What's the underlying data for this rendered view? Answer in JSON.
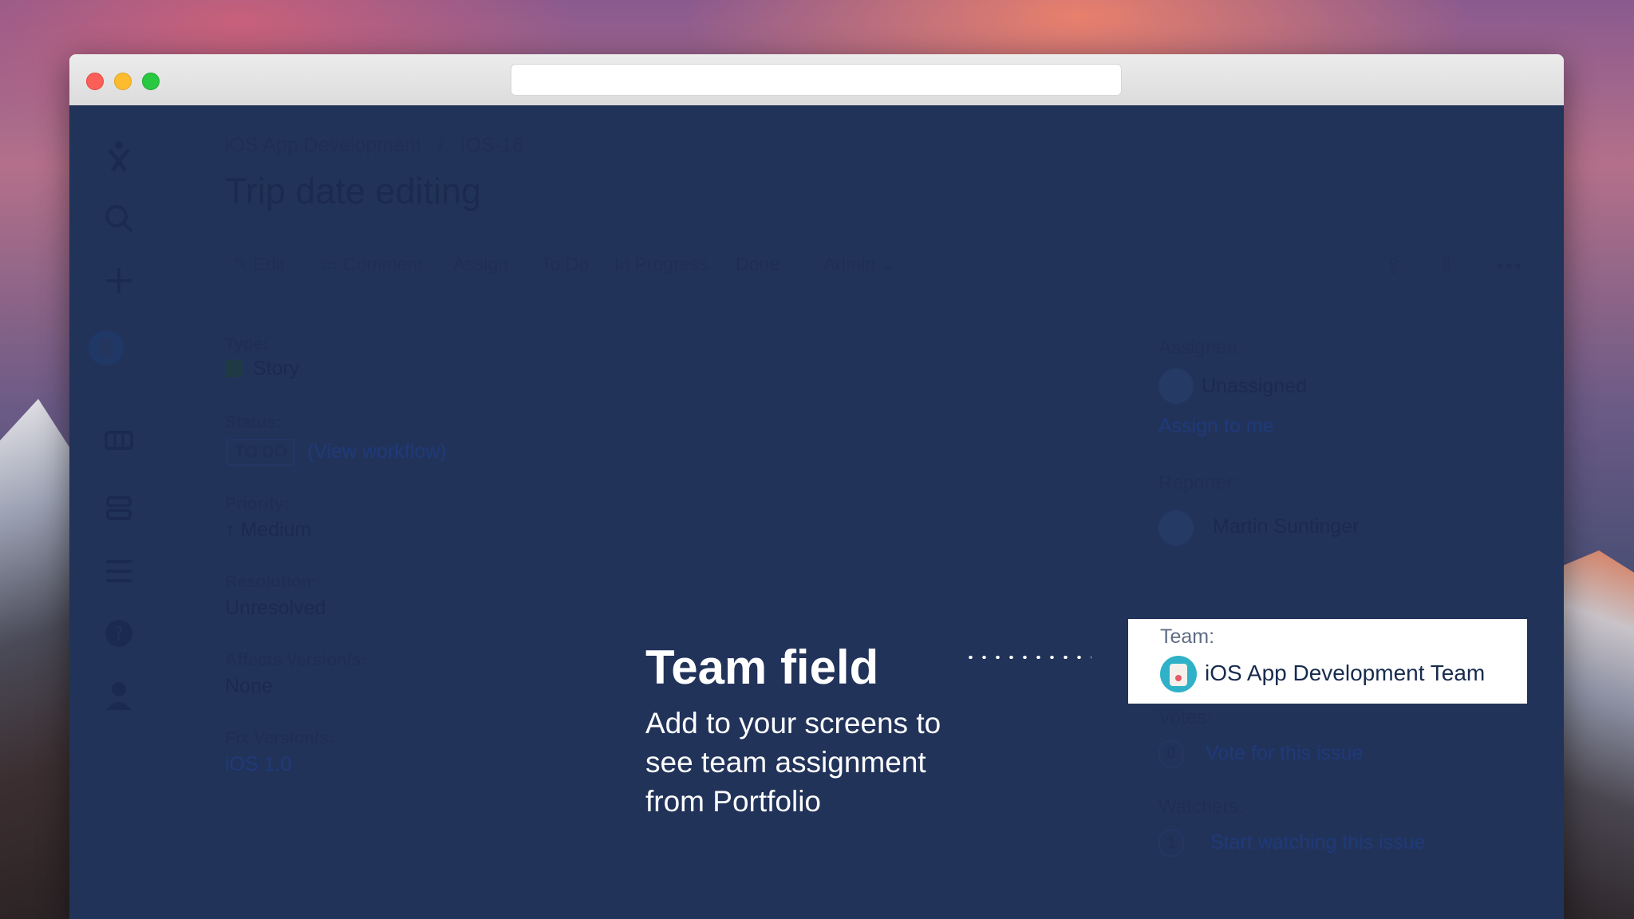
{
  "breadcrumb": {
    "project": "iOS App Development",
    "separator": "/",
    "issue_key": "IOS-16"
  },
  "issue": {
    "title": "Trip date editing"
  },
  "toolbar": {
    "edit": "Edit",
    "comment": "Comment",
    "assign": "Assign",
    "todo": "To Do",
    "in_progress": "In Progress",
    "done": "Done",
    "admin": "Admin"
  },
  "details": {
    "type_label": "Type:",
    "type_value": "Story",
    "status_label": "Status:",
    "status_value": "TO DO",
    "workflow_link": "(View workflow)",
    "priority_label": "Priority:",
    "priority_value": "Medium",
    "resolution_label": "Resolution:",
    "resolution_value": "Unresolved",
    "affects_label": "Affects Version/s:",
    "affects_value": "None",
    "fix_label": "Fix Version/s:",
    "fix_value": "iOS 1.0"
  },
  "people": {
    "assignee_label": "Assignee:",
    "assignee_value": "Unassigned",
    "assign_to_me": "Assign to me",
    "reporter_label": "Reporter:",
    "reporter_value": "Martin Suntinger",
    "team_label": "Team:",
    "team_value": "iOS App Development Team",
    "votes_label": "Votes:",
    "votes_count": "0",
    "vote_link": "Vote for this issue",
    "watchers_label": "Watchers:",
    "watchers_count": "1",
    "watch_link": "Start watching this issue"
  },
  "callout": {
    "title": "Team field",
    "text": "Add to your screens to see team assignment from Portfolio"
  },
  "icons": {
    "sidebar": [
      "jira-logo-icon",
      "search-icon",
      "create-icon",
      "project-avatar-icon",
      "boards-icon",
      "backlog-icon",
      "menu-icon",
      "help-icon",
      "profile-icon"
    ],
    "toolbar": [
      "share-icon",
      "export-icon",
      "more-icon"
    ]
  },
  "colors": {
    "overlay": "#22335a",
    "card": "#ffffff",
    "team_avatar": "#2fb2c8"
  }
}
